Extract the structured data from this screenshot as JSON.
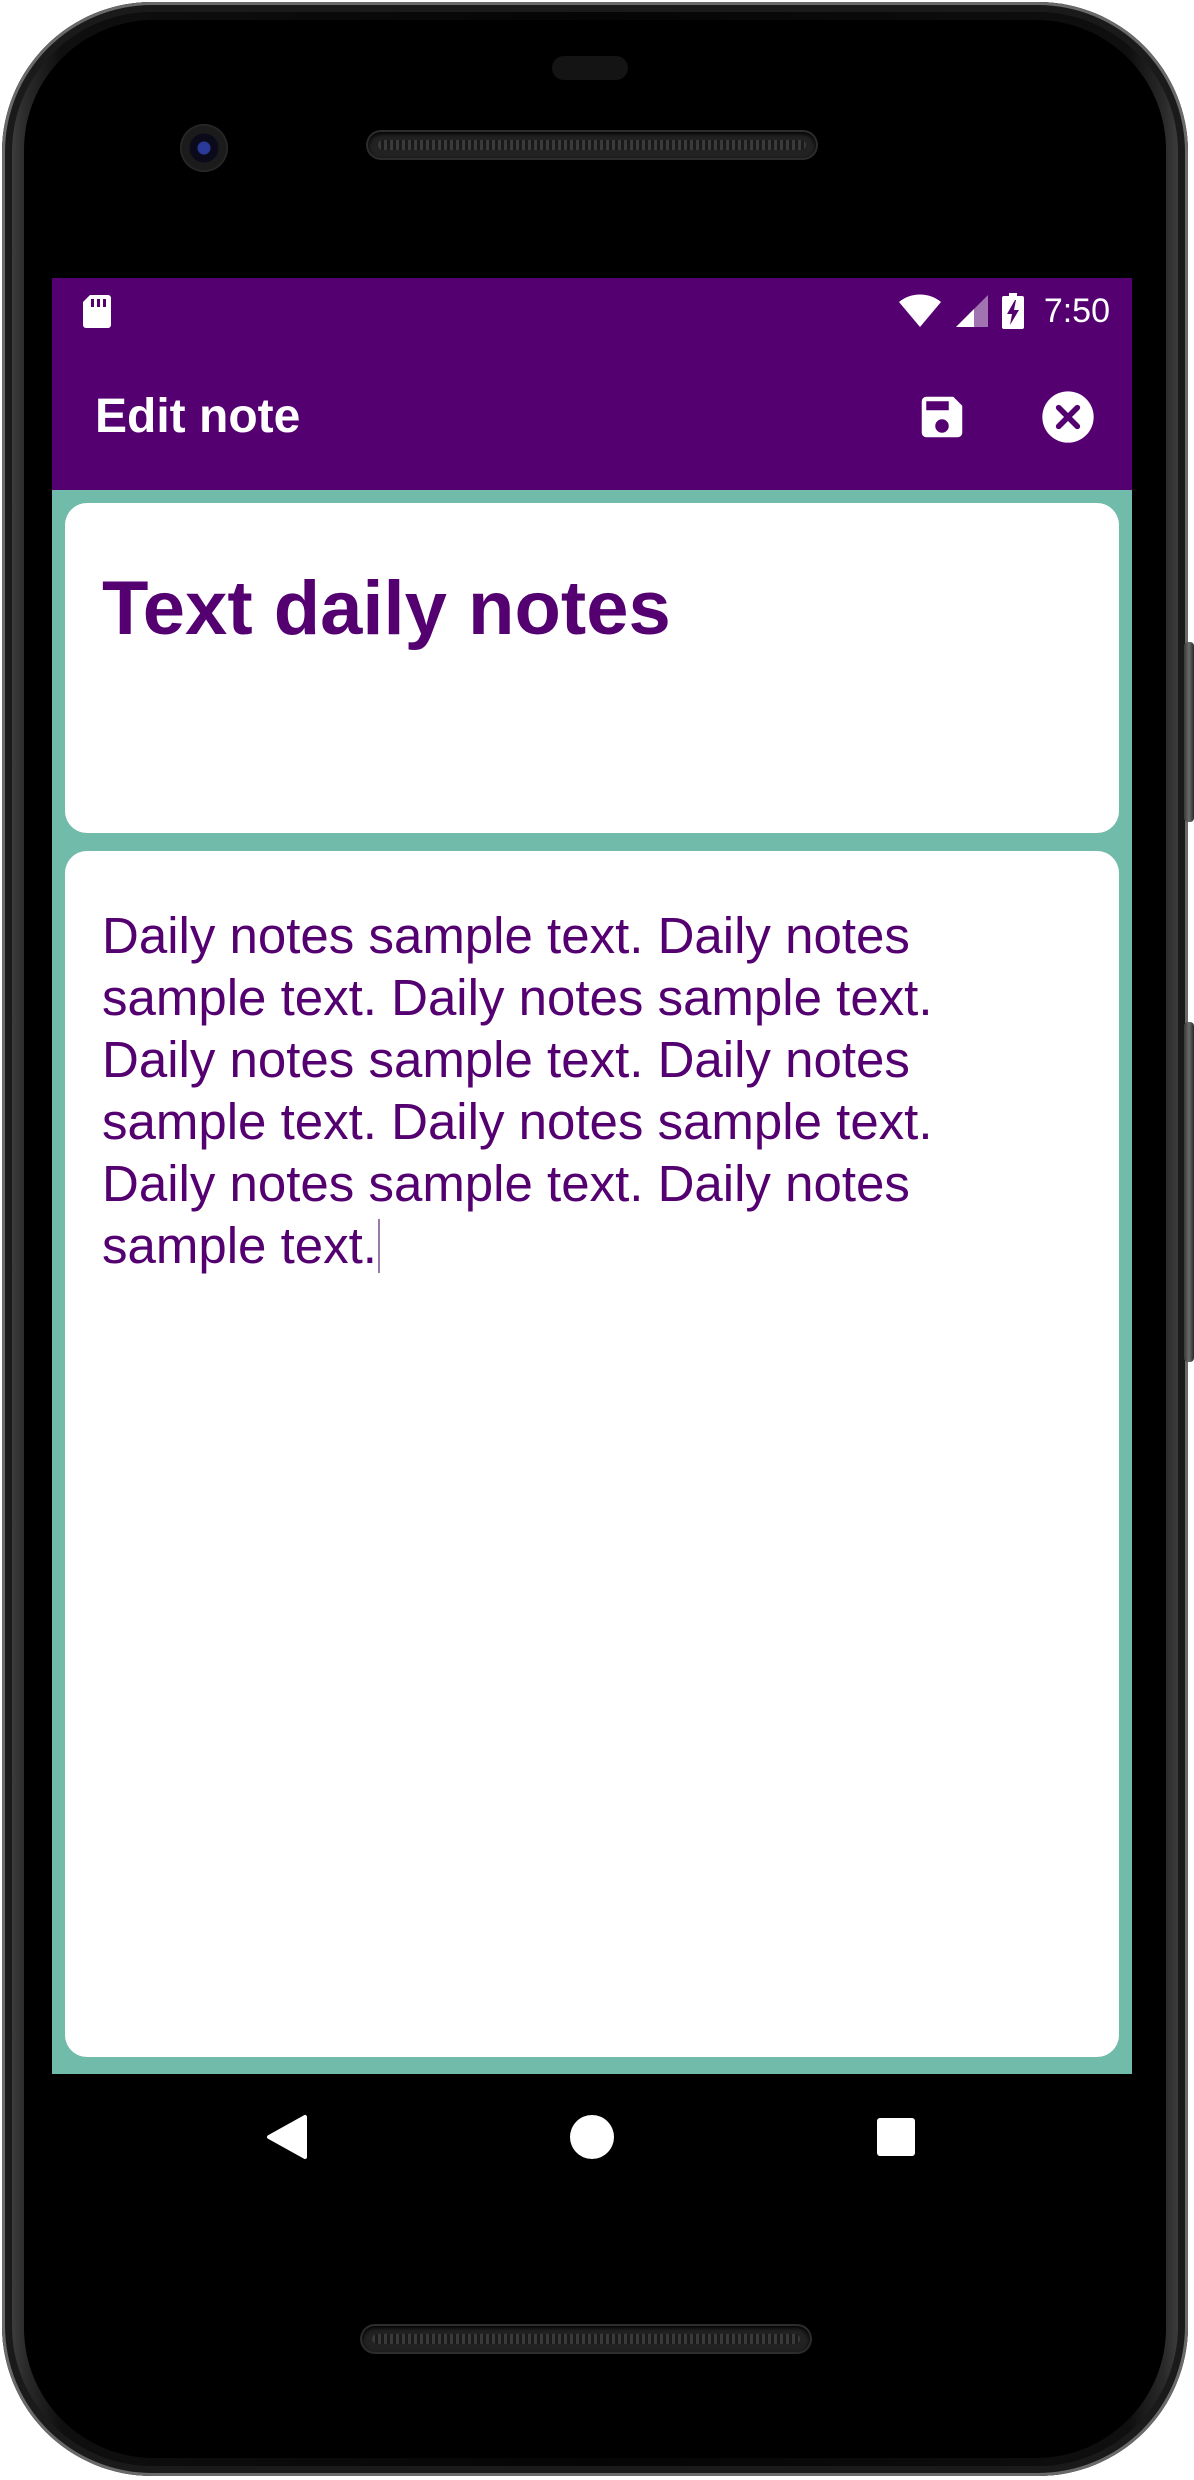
{
  "status_bar": {
    "time": "7:50",
    "icons": [
      "sd-card-icon",
      "wifi-icon",
      "cell-signal-icon",
      "battery-charging-icon"
    ]
  },
  "app_bar": {
    "title": "Edit note",
    "actions": [
      "save-icon",
      "close-circle-icon"
    ]
  },
  "note": {
    "title": "Text daily notes",
    "body": "Daily notes sample text. Daily notes sample text. Daily notes sample text. Daily notes sample text. Daily notes sample text. Daily notes sample text. Daily notes sample text. Daily notes sample text."
  },
  "nav_bar": {
    "buttons": [
      "back-icon",
      "home-icon",
      "recents-icon"
    ]
  },
  "colors": {
    "primary": "#540070",
    "background": "#70bba9",
    "card": "#ffffff",
    "text": "#540070"
  }
}
